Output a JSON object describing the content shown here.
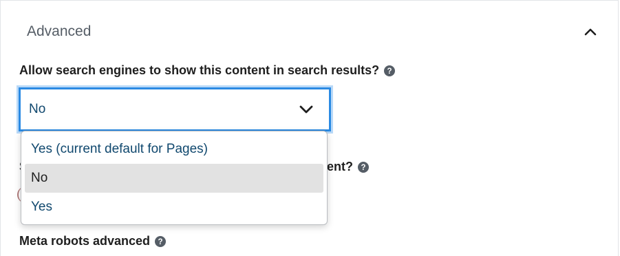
{
  "section": {
    "title": "Advanced",
    "toggle_icon": "chevron-up-icon"
  },
  "search_visibility": {
    "label": "Allow search engines to show this content in search results?",
    "help_icon": "question-circle-icon",
    "selected_value": "No",
    "options": [
      "Yes (current default for Pages)",
      "No",
      "Yes"
    ],
    "selected_index": 1
  },
  "follow_links": {
    "label_visible_start": "S",
    "label_visible_end": "ent?",
    "help_icon": "question-circle-icon"
  },
  "meta_robots": {
    "label": "Meta robots advanced",
    "help_icon": "question-circle-icon"
  },
  "colors": {
    "focus_border": "#2a8ae3",
    "option_text": "#10486e",
    "option_selected_bg": "#e2e2e2"
  }
}
